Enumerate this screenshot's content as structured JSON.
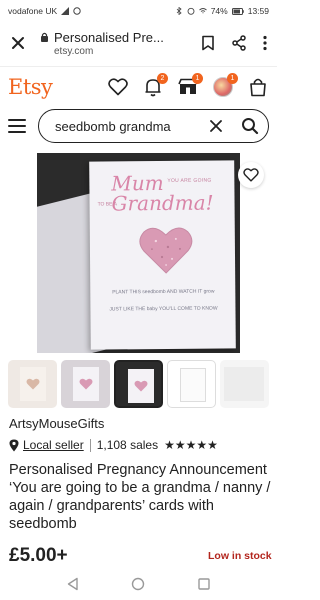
{
  "status_bar": {
    "carrier": "vodafone UK",
    "battery": "74%",
    "time": "13:59"
  },
  "browser": {
    "page_title": "Personalised Pre...",
    "domain": "etsy.com"
  },
  "header": {
    "logo": "Etsy",
    "notification_badge": "2",
    "cart_badge": "1",
    "profile_badge": "1"
  },
  "search": {
    "query": "seedbomb grandma"
  },
  "product_image": {
    "card_line1": "Mum",
    "card_line1_small": "YOU ARE GOING",
    "card_line2_small": "TO BE A",
    "card_line2": "Grandma!",
    "card_line3": "PLANT THIS seedbomb AND WATCH IT grow",
    "card_line4": "JUST LIKE THE baby YOU'LL COME TO KNOW"
  },
  "shop": {
    "name": "ArtsyMouseGifts",
    "local_seller": "Local seller",
    "sales": "1,108 sales",
    "stars": "★★★★★"
  },
  "product": {
    "title": "Personalised Pregnancy Announcement ‘You are going to be a grandma / nanny / again / grandparents’ cards with seedbomb",
    "price": "£5.00+",
    "stock": "Low in stock"
  },
  "colors": {
    "etsy_orange": "#f1641e",
    "stock_red": "#b3261e",
    "card_pink": "#d985a8"
  }
}
